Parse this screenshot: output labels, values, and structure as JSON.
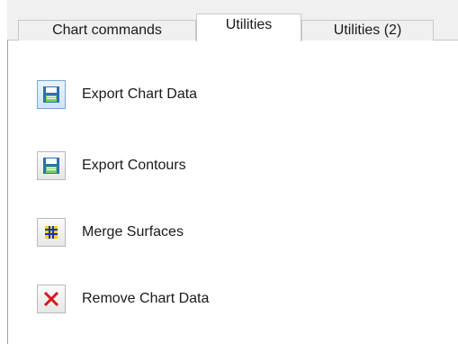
{
  "tabs": [
    {
      "label": "Chart commands"
    },
    {
      "label": "Utilities"
    },
    {
      "label": "Utilities (2)"
    }
  ],
  "selected_tab": "Utilities",
  "utilities": [
    {
      "label": "Export Chart Data",
      "icon": "save-disk-icon"
    },
    {
      "label": "Export Contours",
      "icon": "save-disk-icon"
    },
    {
      "label": "Merge Surfaces",
      "icon": "merge-grid-icon"
    },
    {
      "label": "Remove Chart Data",
      "icon": "red-x-icon"
    }
  ],
  "colors": {
    "disk_blue": "#2f6fb3",
    "disk_green": "#7ccf5d",
    "merge_yellow": "#f3d21a",
    "merge_blue": "#1b2fbf",
    "remove_red": "#d8161b"
  }
}
